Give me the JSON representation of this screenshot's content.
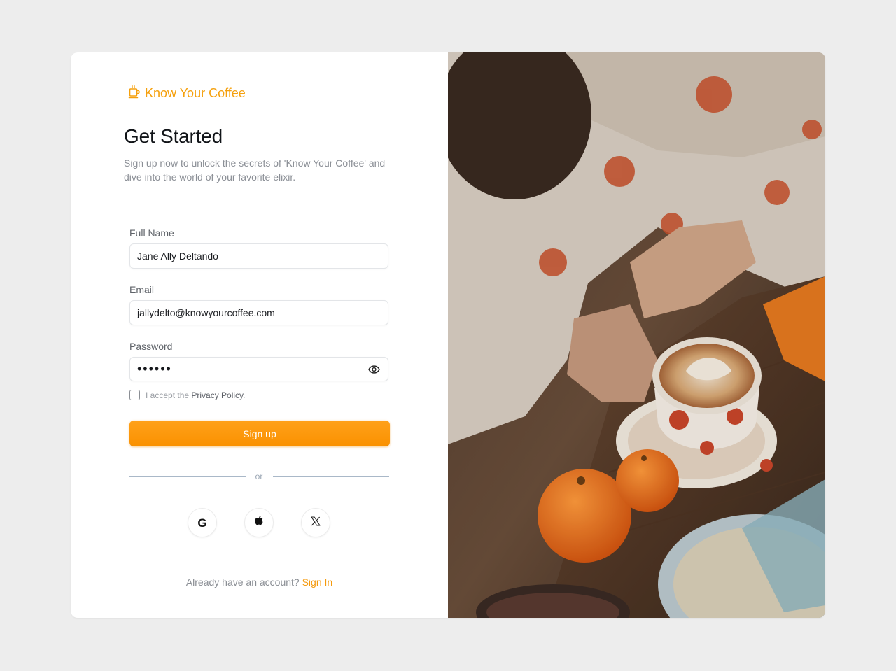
{
  "brand": {
    "name": "Know Your Coffee",
    "icon": "coffee-cup-icon",
    "color": "#f5a00d"
  },
  "header": {
    "title": "Get Started",
    "subtitle": "Sign up now to unlock the secrets of 'Know Your Coffee' and dive into the world of your favorite elixir."
  },
  "form": {
    "full_name": {
      "label": "Full Name",
      "value": "Jane Ally Deltando"
    },
    "email": {
      "label": "Email",
      "value": "jallydelto@knowyourcoffee.com"
    },
    "password": {
      "label": "Password",
      "masked": "••••••",
      "toggle_icon": "eye-icon"
    },
    "privacy": {
      "prefix": "I accept the ",
      "link": "Privacy Policy",
      "suffix": ".",
      "checked": false
    },
    "submit_label": "Sign up"
  },
  "divider": {
    "label": "or"
  },
  "social": [
    {
      "name": "google",
      "glyph": "G",
      "icon": "google-icon"
    },
    {
      "name": "apple",
      "glyph": "",
      "icon": "apple-icon"
    },
    {
      "name": "x",
      "glyph": "𝕏",
      "icon": "x-icon"
    }
  ],
  "footer": {
    "prompt": "Already have an account? ",
    "link": "Sign In"
  },
  "colors": {
    "accent": "#f59a0c",
    "button": "#fa9100",
    "background": "#ededed"
  }
}
